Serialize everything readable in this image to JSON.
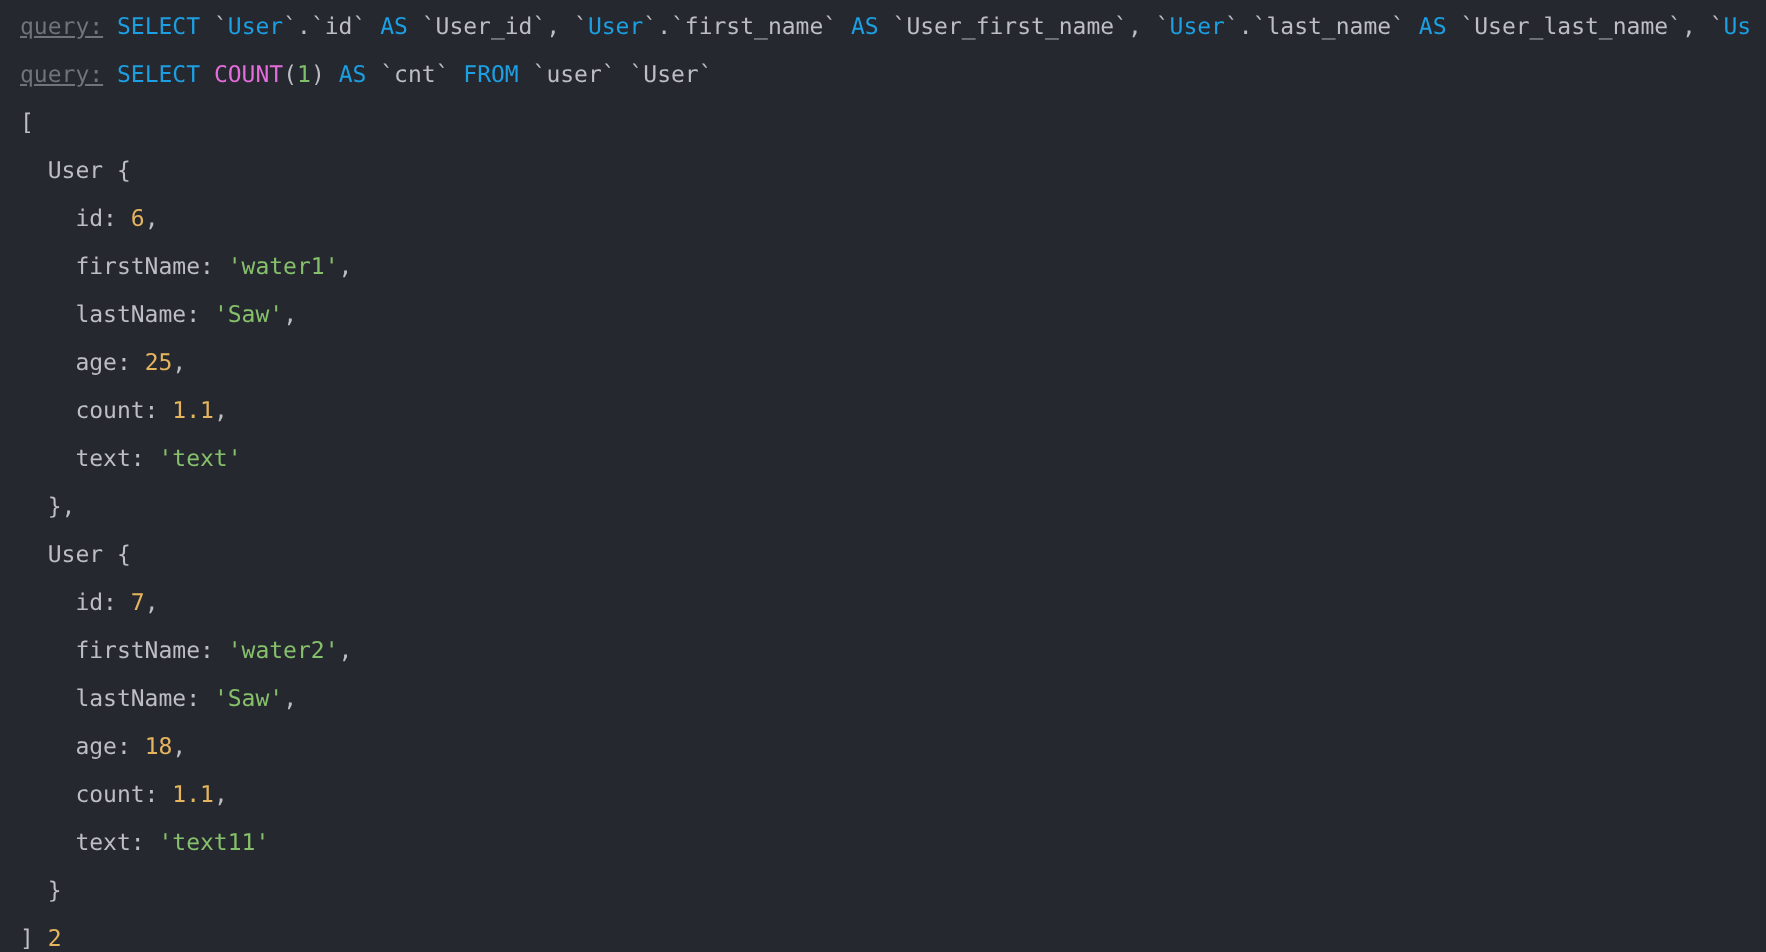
{
  "queries": [
    {
      "label": "query:",
      "tokens": [
        {
          "kind": "keyword",
          "text": "SELECT"
        },
        {
          "kind": "plain",
          "text": " `"
        },
        {
          "kind": "identifier",
          "text": "User"
        },
        {
          "kind": "plain",
          "text": "`.`id` "
        },
        {
          "kind": "keyword",
          "text": "AS"
        },
        {
          "kind": "plain",
          "text": " `User_id`, `"
        },
        {
          "kind": "identifier",
          "text": "User"
        },
        {
          "kind": "plain",
          "text": "`.`first_name` "
        },
        {
          "kind": "keyword",
          "text": "AS"
        },
        {
          "kind": "plain",
          "text": " `User_first_name`, `"
        },
        {
          "kind": "identifier",
          "text": "User"
        },
        {
          "kind": "plain",
          "text": "`.`last_name` "
        },
        {
          "kind": "keyword",
          "text": "AS"
        },
        {
          "kind": "plain",
          "text": " `User_last_name`, `"
        },
        {
          "kind": "identifier",
          "text": "Us"
        }
      ]
    },
    {
      "label": "query:",
      "tokens": [
        {
          "kind": "keyword",
          "text": "SELECT "
        },
        {
          "kind": "function",
          "text": "COUNT"
        },
        {
          "kind": "plain",
          "text": "("
        },
        {
          "kind": "numeric",
          "text": "1"
        },
        {
          "kind": "plain",
          "text": ") "
        },
        {
          "kind": "keyword",
          "text": "AS"
        },
        {
          "kind": "plain",
          "text": " `cnt` "
        },
        {
          "kind": "keyword",
          "text": "FROM"
        },
        {
          "kind": "plain",
          "text": " `user` `User`"
        }
      ]
    }
  ],
  "result": {
    "open": "[",
    "records": [
      {
        "header": "User {",
        "fields": [
          {
            "key": "id: ",
            "value": "6",
            "kind": "number",
            "trail": ","
          },
          {
            "key": "firstName: ",
            "value": "'water1'",
            "kind": "string",
            "trail": ","
          },
          {
            "key": "lastName: ",
            "value": "'Saw'",
            "kind": "string",
            "trail": ","
          },
          {
            "key": "age: ",
            "value": "25",
            "kind": "number",
            "trail": ","
          },
          {
            "key": "count: ",
            "value": "1.1",
            "kind": "number",
            "trail": ","
          },
          {
            "key": "text: ",
            "value": "'text'",
            "kind": "string"
          }
        ],
        "close": "},"
      },
      {
        "header": "User {",
        "fields": [
          {
            "key": "id: ",
            "value": "7",
            "kind": "number",
            "trail": ","
          },
          {
            "key": "firstName: ",
            "value": "'water2'",
            "kind": "string",
            "trail": ","
          },
          {
            "key": "lastName: ",
            "value": "'Saw'",
            "kind": "string",
            "trail": ","
          },
          {
            "key": "age: ",
            "value": "18",
            "kind": "number",
            "trail": ","
          },
          {
            "key": "count: ",
            "value": "1.1",
            "kind": "number",
            "trail": ","
          },
          {
            "key": "text: ",
            "value": "'text11'",
            "kind": "string"
          }
        ],
        "close": "}"
      }
    ],
    "close": "]",
    "count": "2"
  }
}
